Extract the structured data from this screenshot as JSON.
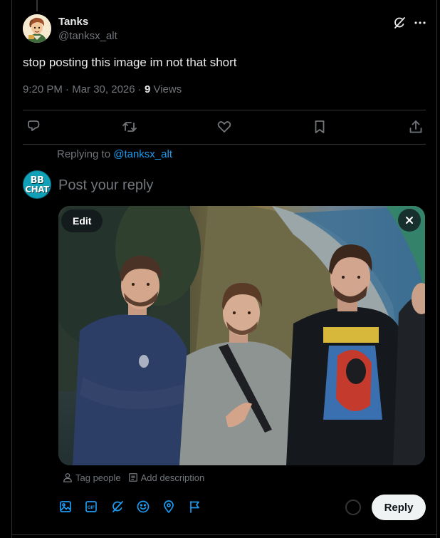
{
  "tweet": {
    "author_name": "Tanks",
    "author_handle": "@tanksx_alt",
    "text": "stop posting this image im not that short",
    "time": "9:20 PM",
    "separator": "·",
    "date": "Mar 30, 2026",
    "views_count": "9",
    "views_label": "Views"
  },
  "reply": {
    "replying_prefix": "Replying to",
    "replying_handle": "@tanksx_alt",
    "placeholder": "Post your reply",
    "media_edit_label": "Edit",
    "tag_people_label": "Tag people",
    "add_description_label": "Add description",
    "reply_button_label": "Reply"
  },
  "avatars": {
    "reply_avatar_line1": "BB",
    "reply_avatar_line2": "CHAT"
  },
  "icons": {
    "header": [
      "grok-icon",
      "more-icon"
    ],
    "actions": [
      "reply-icon",
      "retweet-icon",
      "like-icon",
      "bookmark-icon",
      "share-icon"
    ],
    "media_tools": [
      "person-icon",
      "description-icon"
    ],
    "toolbar": [
      "image-icon",
      "gif-icon",
      "grok-icon",
      "emoji-icon",
      "location-icon",
      "flag-icon"
    ]
  },
  "colors": {
    "background": "#000000",
    "text_primary": "#e7e9ea",
    "text_secondary": "#71767b",
    "accent": "#1d9bf0",
    "divider": "#2f3336",
    "reply_button_bg": "#eff3f4"
  }
}
